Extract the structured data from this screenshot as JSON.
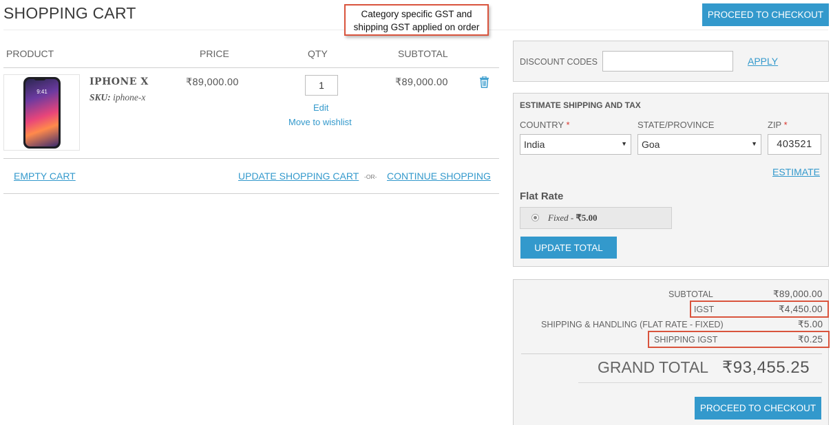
{
  "header": {
    "title": "SHOPPING CART",
    "checkout_button": "PROCEED TO CHECKOUT",
    "callout_line1": "Category specific GST and",
    "callout_line2": "shipping GST applied on order"
  },
  "table": {
    "columns": [
      "PRODUCT",
      "PRICE",
      "QTY",
      "SUBTOTAL"
    ]
  },
  "item": {
    "name": "IPHONE X",
    "sku_label": "SKU:",
    "sku_value": "iphone-x",
    "price": "₹89,000.00",
    "qty": "1",
    "subtotal": "₹89,000.00",
    "edit_label": "Edit",
    "wishlist_label": "Move to wishlist",
    "image_time": "9:41"
  },
  "cart_actions": {
    "empty": "EMPTY CART",
    "update": "UPDATE SHOPPING CART",
    "or": "-OR-",
    "continue": "CONTINUE SHOPPING"
  },
  "discount": {
    "label": "DISCOUNT CODES",
    "value": "",
    "apply": "APPLY"
  },
  "shipping": {
    "title": "ESTIMATE SHIPPING AND TAX",
    "country_label": "COUNTRY",
    "state_label": "STATE/PROVINCE",
    "zip_label": "ZIP",
    "required_mark": "*",
    "country_value": "India",
    "state_value": "Goa",
    "zip_value": "403521",
    "estimate": "ESTIMATE",
    "method_title": "Flat Rate",
    "rate_name": "Fixed",
    "rate_sep": " - ",
    "rate_price": "₹5.00",
    "update_total": "UPDATE TOTAL"
  },
  "totals": {
    "subtotal_label": "SUBTOTAL",
    "subtotal_value": "₹89,000.00",
    "igst_label": "IGST",
    "igst_value": "₹4,450.00",
    "shipping_label": "SHIPPING & HANDLING (FLAT RATE - FIXED)",
    "shipping_value": "₹5.00",
    "ship_igst_label": "SHIPPING IGST",
    "ship_igst_value": "₹0.25",
    "grand_label": "GRAND TOTAL",
    "grand_value": "₹93,455.25",
    "checkout_button": "PROCEED TO CHECKOUT"
  },
  "colors": {
    "accent": "#3399cc",
    "highlight": "#d9533c",
    "panel_bg": "#f4f4f4",
    "required": "#d9342b"
  },
  "icons": [
    "trash-icon",
    "dropdown-arrow-icon",
    "radio-icon"
  ]
}
